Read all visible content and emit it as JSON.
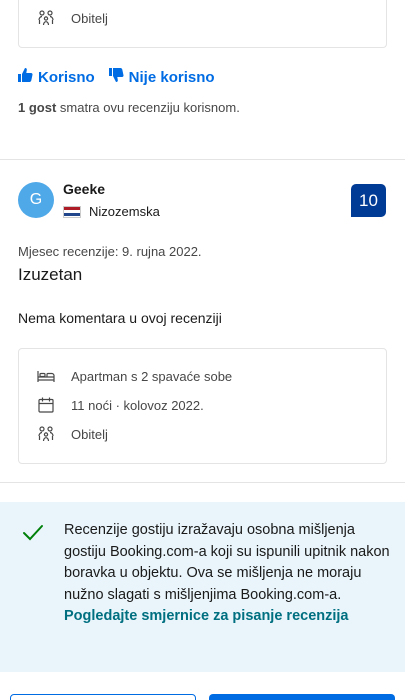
{
  "previous_review": {
    "stay_type": "Obitelj",
    "helpful_label": "Korisno",
    "not_helpful_label": "Nije korisno",
    "found_helpful_count": "1 gost",
    "found_helpful_suffix": " smatra ovu recenziju korisnom."
  },
  "review": {
    "avatar_initial": "G",
    "reviewer_name": "Geeke",
    "country": "Nizozemska",
    "score": "10",
    "date": "Mjesec recenzije: 9. rujna 2022.",
    "title": "Izuzetan",
    "comment": "Nema komentara u ovoj recenziji",
    "room_type": "Apartman s 2 spavaće sobe",
    "stay_duration": "11 noći · kolovoz 2022.",
    "traveler_type": "Obitelj"
  },
  "notice": {
    "text": "Recenzije gostiju izražavaju osobna mišljenja gostiju Booking.com-a koji su ispunili upitnik nakon boravka u objektu. Ova se mišljenja ne moraju nužno slagati s mišljenjima Booking.com-a.",
    "link": "Pogledajte smjernice za pisanje recenzija"
  },
  "colors": {
    "accent_blue": "#006ce4",
    "score_bg": "#003b95",
    "notice_bg": "#e9f5fb",
    "link_teal": "#006f80",
    "check_green": "#008009"
  },
  "icons": {
    "family": "family-icon",
    "thumb_up": "thumbs-up-icon",
    "thumb_down": "thumbs-down-icon",
    "bed": "bed-icon",
    "calendar": "calendar-icon",
    "check": "checkmark-icon"
  }
}
